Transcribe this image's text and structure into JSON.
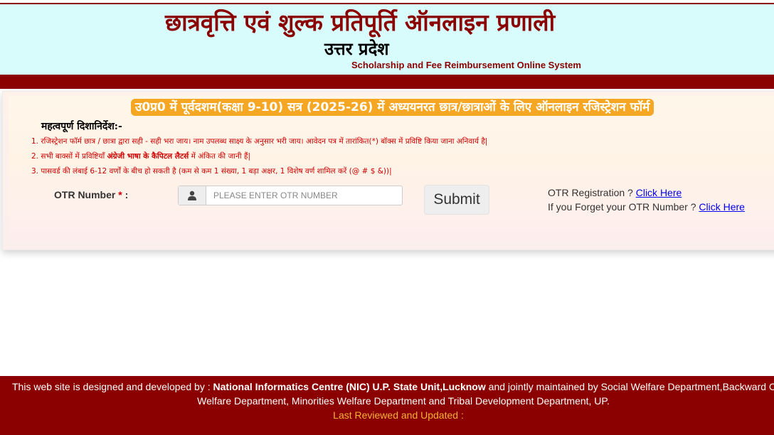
{
  "header": {
    "title_hi": "छात्रवृत्ति एवं शुल्क प्रतिपूर्ति ऑनलाइन प्रणाली",
    "state_hi": "उत्तर प्रदेश",
    "title_en": "Scholarship and Fee Reimbursement Online System"
  },
  "form": {
    "title": "उ0प्र0 में पूर्वदशम(कक्षा 9-10) सत्र (2025-26) में अध्ययनरत छात्र/छात्राओं के लिए ऑनलाइन रजिस्ट्रेशन फॉर्म",
    "guidelines_title": "महत्वपूर्ण दिशानिर्देश:-",
    "notes": {
      "n1": "1. रजिस्ट्रेशन फॉर्म छात्र / छात्रा द्वारा सही - सही भरा जाय। नाम उपलब्ध साक्ष्य के अनुसार भरी जाय। आवेदन पत्र में तारांकित(*) बॉक्स में प्रविष्टि किया जाना अनिवार्य है|",
      "n2_pre": "2. सभी बाक्सों में प्रविष्टियाँ ",
      "n2_bold": "अंग्रेजी भाषा के कैपिटल लैटर्स",
      "n2_post": " में अंकित की जानी हैं|",
      "n3": "3. पासवर्ड की लंबाई 6-12 वर्णों के बीच हो सकती है (कम से कम 1 संख्या, 1 बड़ा अक्षर, 1 विशेष वर्ण शामिल करें (@ # $ &))|"
    },
    "otr_label": "OTR Number",
    "otr_star": "*",
    "otr_colon": " :",
    "otr_placeholder": "PLEASE ENTER OTR NUMBER",
    "otr_value": "",
    "submit_label": "Submit",
    "registration_text": "OTR Registration ? ",
    "registration_link": "Click Here",
    "forget_text": "If you Forget your OTR Number ? ",
    "forget_link": "Click Here"
  },
  "footer": {
    "line1_pre": "This web site is designed and developed by : ",
    "line1_bold": "National Informatics Centre (NIC) U.P. State Unit,Lucknow",
    "line1_post": " and jointly maintained by Social Welfare Department,Backward Class",
    "line2": "Welfare Department, Minorities Welfare Department and Tribal Development Department, UP.",
    "line3": "Last Reviewed and Updated :"
  },
  "colors": {
    "brand_maroon": "#8b0000",
    "header_bg": "#d8fbfb",
    "form_title_bg": "#f5a623",
    "note_red": "#cc0000",
    "link_blue": "#0000ee",
    "footer_date": "#f5b335"
  },
  "icons": {
    "input_addon": "user-icon"
  }
}
